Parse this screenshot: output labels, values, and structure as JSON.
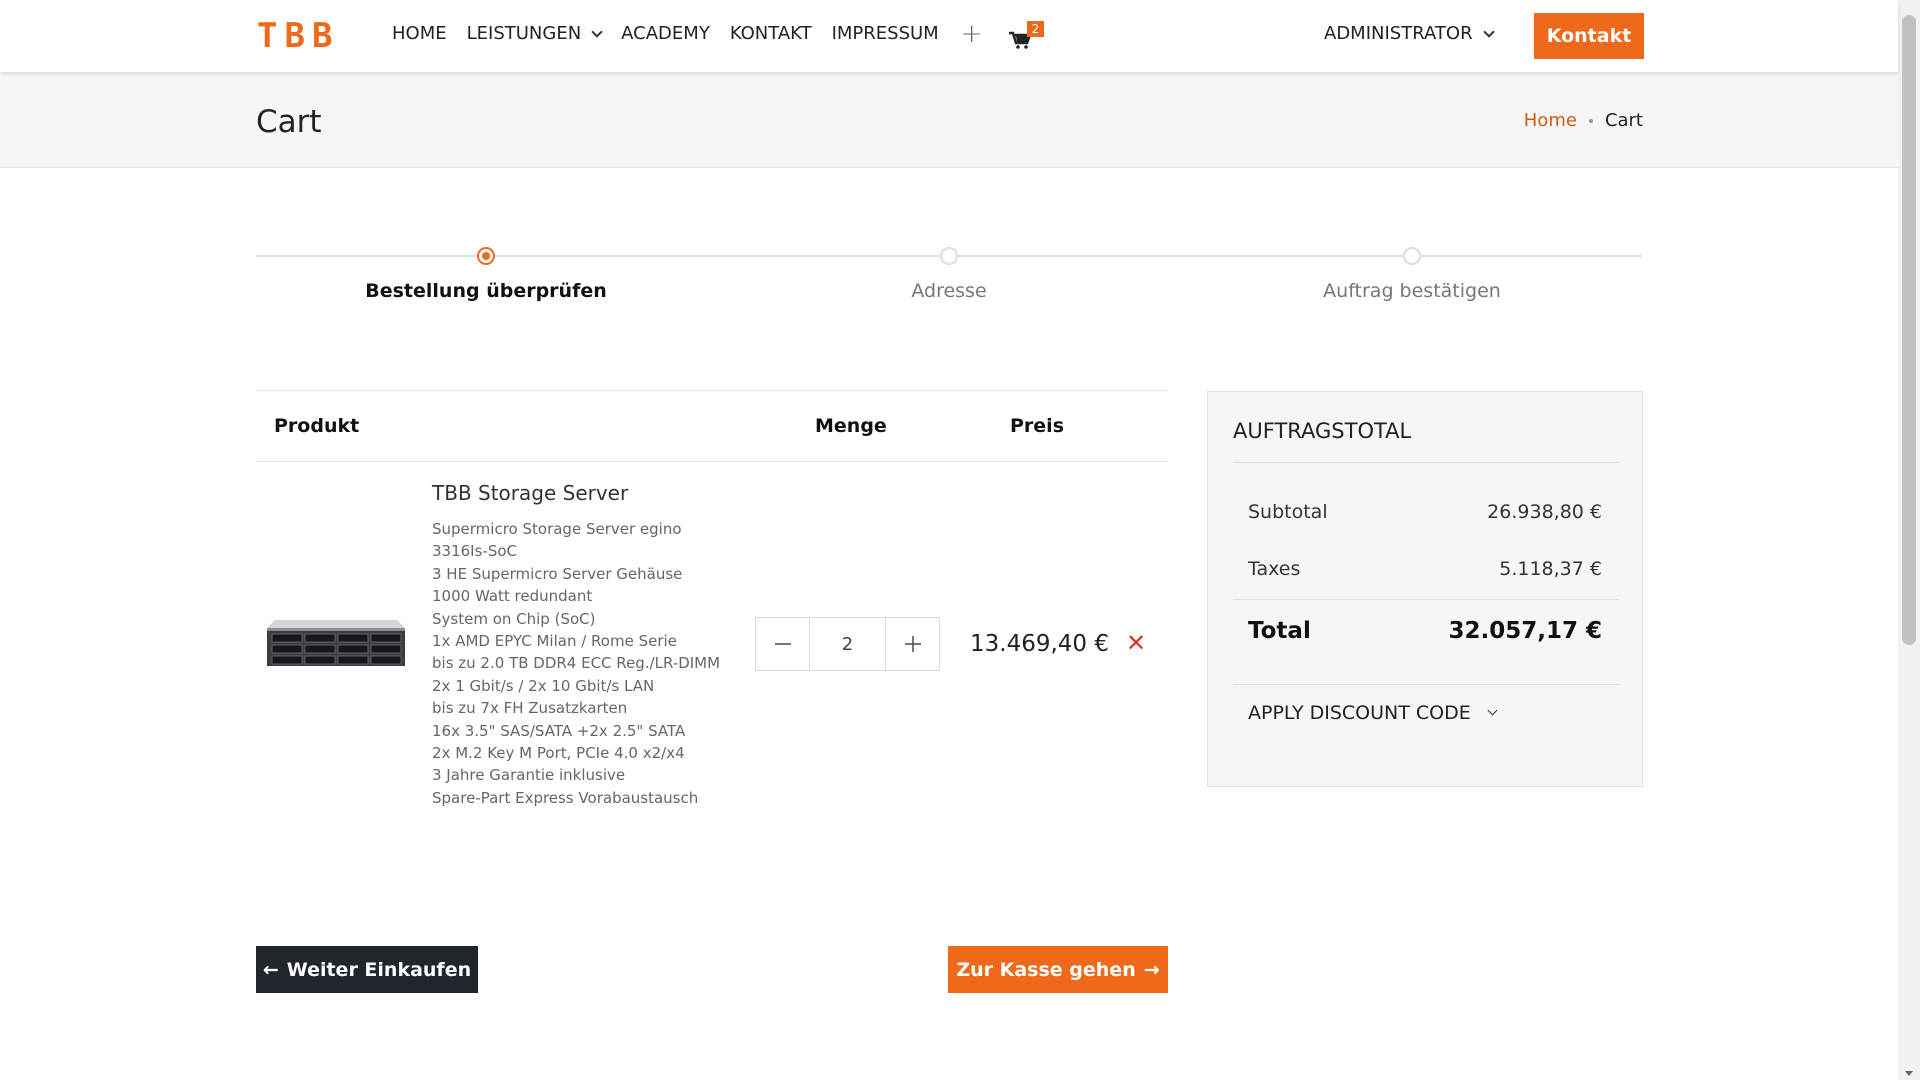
{
  "header": {
    "logo": "TBB",
    "nav": [
      {
        "label": "HOME"
      },
      {
        "label": "LEISTUNGEN"
      },
      {
        "label": "ACADEMY"
      },
      {
        "label": "KONTAKT"
      },
      {
        "label": "IMPRESSUM"
      }
    ],
    "cart_count": "2",
    "user_menu": "ADMINISTRATOR",
    "cta": "Kontakt"
  },
  "page": {
    "title": "Cart",
    "breadcrumb": {
      "home": "Home",
      "current": "Cart"
    }
  },
  "steps": [
    {
      "label": "Bestellung überprüfen",
      "active": true
    },
    {
      "label": "Adresse",
      "active": false
    },
    {
      "label": "Auftrag bestätigen",
      "active": false
    }
  ],
  "table": {
    "headers": {
      "product": "Produkt",
      "quantity": "Menge",
      "price": "Preis"
    }
  },
  "item": {
    "name": "TBB Storage Server",
    "description": [
      "Supermicro Storage Server egino",
      "3316Is-SoC",
      "3 HE Supermicro Server Gehäuse",
      "1000 Watt redundant",
      "System on Chip (SoC)",
      "1x AMD EPYC Milan / Rome Serie",
      "bis zu 2.0 TB DDR4 ECC Reg./LR-DIMM",
      "2x 1 Gbit/s / 2x 10 Gbit/s LAN",
      "bis zu 7x FH Zusatzkarten",
      "16x 3.5\" SAS/SATA +2x 2.5\" SATA",
      "2x M.2 Key M Port, PCIe 4.0 x2/x4",
      "3 Jahre Garantie inklusive",
      "Spare-Part Express Vorabaustausch"
    ],
    "quantity": "2",
    "price": "13.469,40 €"
  },
  "buttons": {
    "continue_shopping": "Weiter Einkaufen",
    "checkout": "Zur Kasse gehen"
  },
  "summary": {
    "title": "AUFTRAGSTOTAL",
    "subtotal_label": "Subtotal",
    "subtotal_value": "26.938,80 €",
    "taxes_label": "Taxes",
    "taxes_value": "5.118,37 €",
    "total_label": "Total",
    "total_value": "32.057,17 €",
    "discount_label": "APPLY DISCOUNT CODE"
  },
  "colors": {
    "accent": "#ee6a1a",
    "dark_button": "#20262b",
    "remove": "#d9332b"
  }
}
